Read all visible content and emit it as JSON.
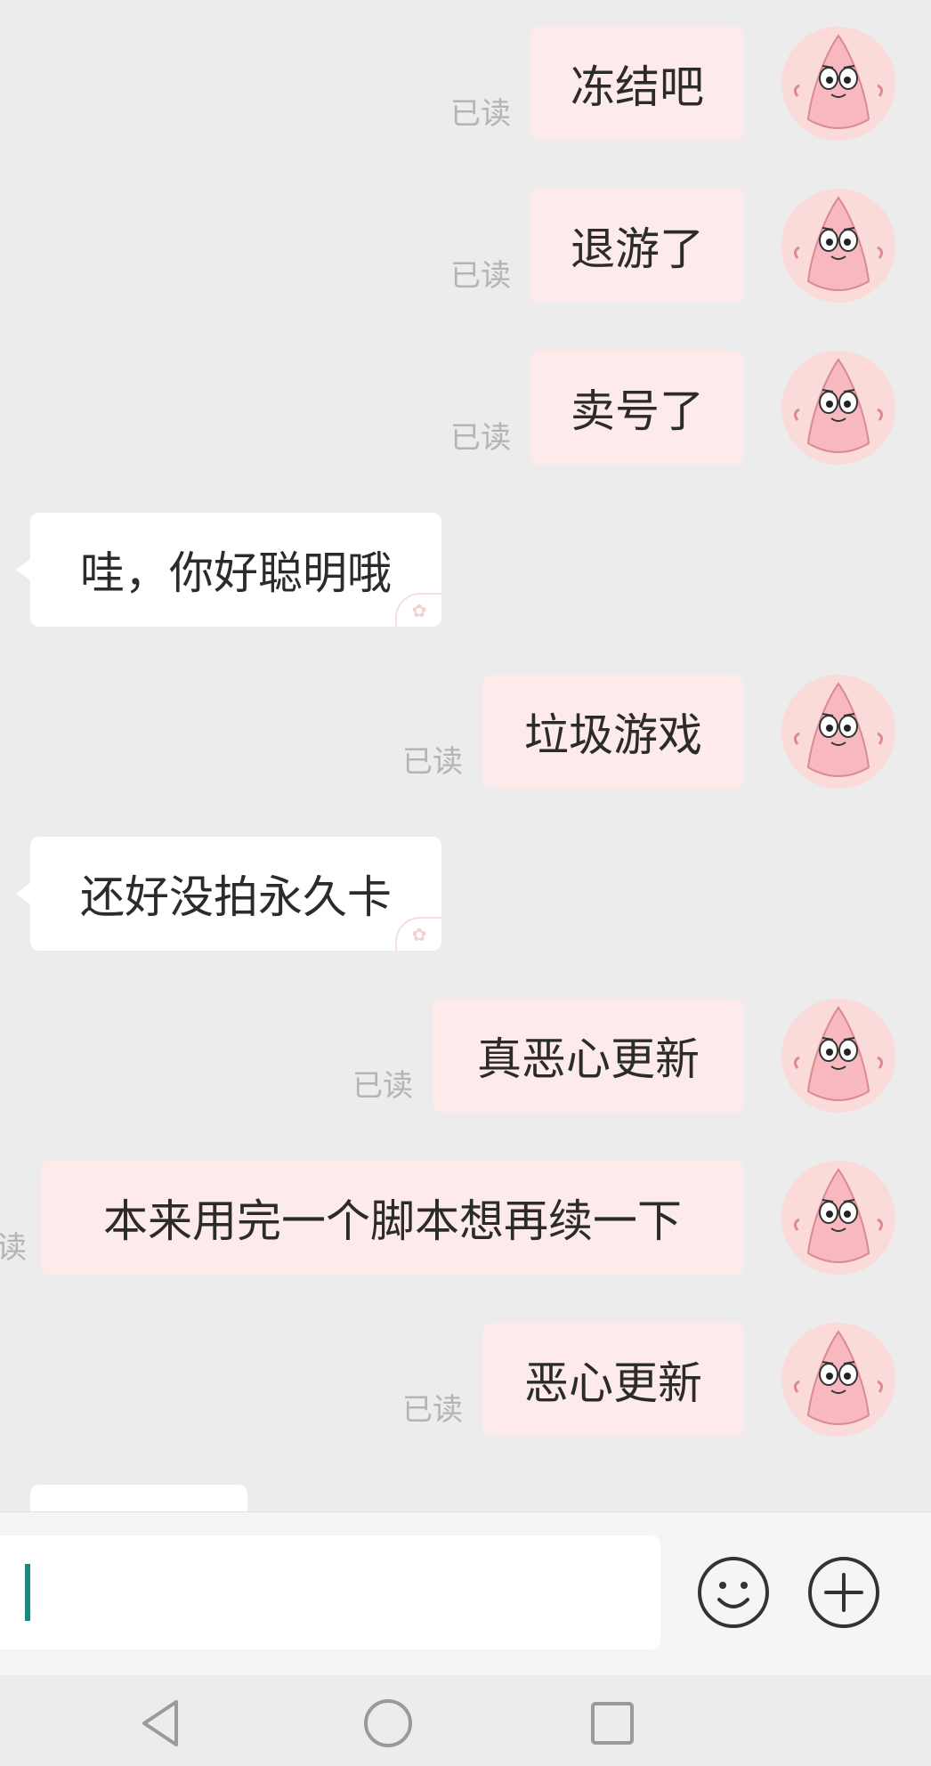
{
  "read_label": "已读",
  "avatar_icon": "patrick-star-avatar",
  "colors": {
    "background": "#ececec",
    "outgoing_bubble": "#fdeaea",
    "incoming_bubble": "#ffffff",
    "cursor": "#1a8a80"
  },
  "messages": [
    {
      "direction": "outgoing",
      "text": "冻结吧",
      "read": "已读"
    },
    {
      "direction": "outgoing",
      "text": "退游了",
      "read": "已读"
    },
    {
      "direction": "outgoing",
      "text": "卖号了",
      "read": "已读"
    },
    {
      "direction": "incoming",
      "text": "哇，你好聪明哦"
    },
    {
      "direction": "outgoing",
      "text": "垃圾游戏",
      "read": "已读"
    },
    {
      "direction": "incoming",
      "text": "还好没拍永久卡"
    },
    {
      "direction": "outgoing",
      "text": "真恶心更新",
      "read": "已读"
    },
    {
      "direction": "outgoing",
      "text": "本来用完一个脚本想再续一下",
      "read": "已读"
    },
    {
      "direction": "outgoing",
      "text": "恶心更新",
      "read": "已读"
    },
    {
      "direction": "incoming",
      "text": ""
    }
  ],
  "input": {
    "value": ""
  },
  "icons": {
    "emoji": "smiley-icon",
    "plus": "plus-icon",
    "back": "back-triangle-icon",
    "home": "home-circle-icon",
    "recents": "recents-square-icon"
  }
}
